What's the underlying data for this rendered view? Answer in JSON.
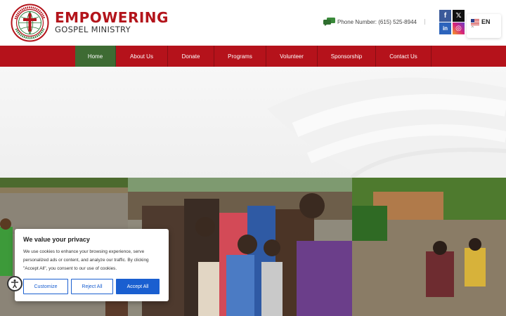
{
  "brand": {
    "seal_text": "Empowering Gospel Ministry",
    "line1": "EMPOWERING",
    "line2": "GOSPEL MINISTRY"
  },
  "header": {
    "phone": "Phone Number: (615) 525-8944",
    "social": {
      "facebook": "f",
      "x": "𝕏",
      "linkedin": "in",
      "instagram": "◎"
    },
    "language": {
      "code": "EN",
      "caret": "⌃"
    }
  },
  "nav": {
    "items": [
      {
        "label": "Home",
        "active": true
      },
      {
        "label": "About Us"
      },
      {
        "label": "Donate"
      },
      {
        "label": "Programs"
      },
      {
        "label": "Volunteer"
      },
      {
        "label": "Sponsorship"
      },
      {
        "label": "Contact Us"
      }
    ]
  },
  "cookie": {
    "title": "We value your privacy",
    "text": "We use cookies to enhance your browsing experience, serve personalized ads or content, and analyze our traffic. By clicking \"Accept All\", you consent to our use of cookies.",
    "customize": "Customize",
    "reject": "Reject All",
    "accept": "Accept All"
  },
  "colors": {
    "brand_red": "#b5121b",
    "nav_active": "#3e6b33",
    "cookie_blue": "#1a5fd0"
  },
  "icons": [
    "phone-chat-icon",
    "facebook-icon",
    "x-icon",
    "linkedin-icon",
    "instagram-icon",
    "us-flag-icon",
    "accessibility-icon"
  ]
}
